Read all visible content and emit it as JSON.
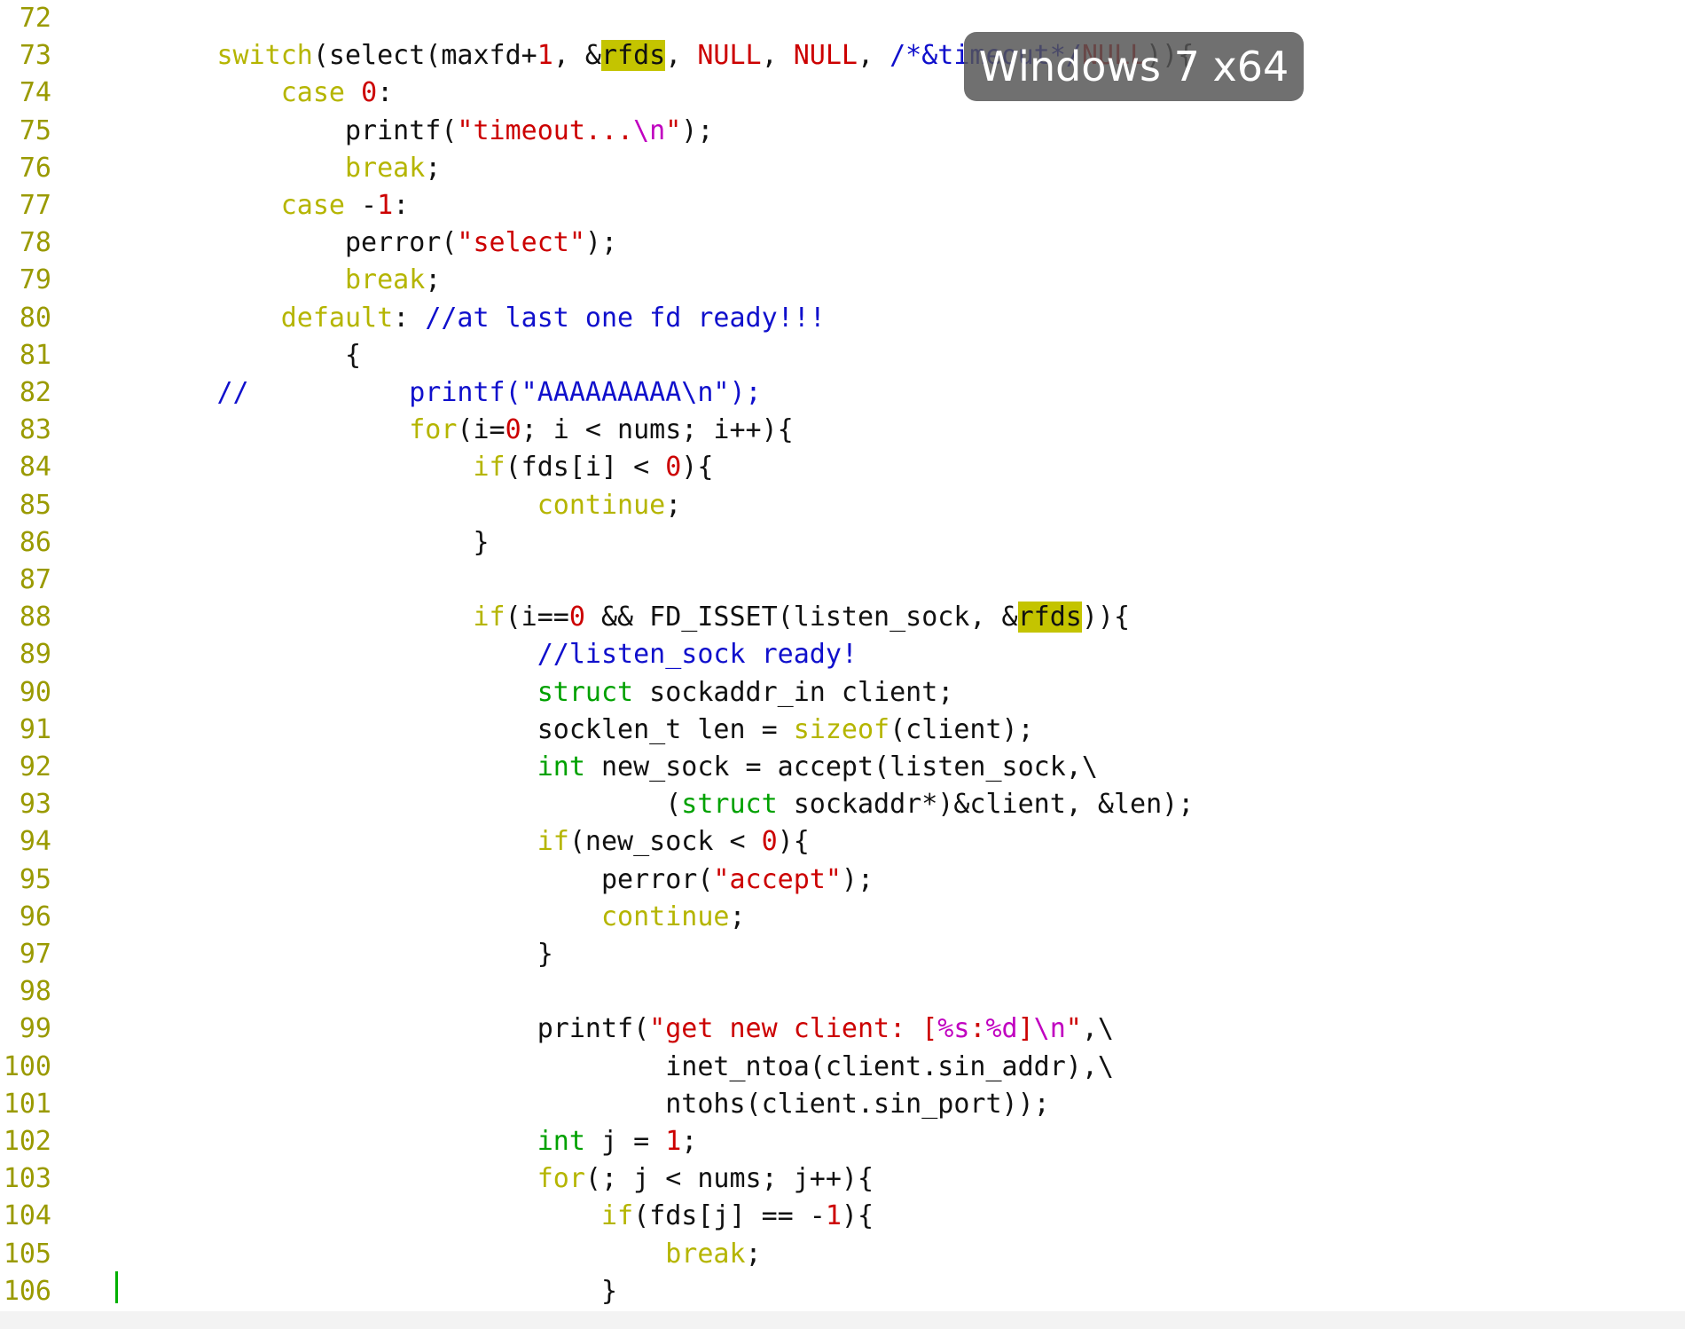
{
  "overlay": {
    "label": "Windows 7 x64"
  },
  "colors": {
    "line_number": "#9a9a00",
    "keyword": "#b5b500",
    "type": "#00a100",
    "number_string": "#cc0000",
    "escape": "#c000c0",
    "comment": "#1010cc",
    "search_highlight": "#c4c400",
    "cursor": "#00b000"
  },
  "lines": [
    {
      "n": "72",
      "tokens": []
    },
    {
      "n": "73",
      "tokens": [
        {
          "t": "        "
        },
        {
          "t": "switch",
          "c": "kw"
        },
        {
          "t": "(select(maxfd+"
        },
        {
          "t": "1",
          "c": "num"
        },
        {
          "t": ", &"
        },
        {
          "t": "rfds",
          "c": "hl"
        },
        {
          "t": ", "
        },
        {
          "t": "NULL",
          "c": "num"
        },
        {
          "t": ", "
        },
        {
          "t": "NULL",
          "c": "num"
        },
        {
          "t": ", "
        },
        {
          "t": "/*&timeout*/",
          "c": "cm"
        },
        {
          "t": "NULL",
          "c": "num"
        },
        {
          "t": ")){"
        }
      ]
    },
    {
      "n": "74",
      "tokens": [
        {
          "t": "            "
        },
        {
          "t": "case",
          "c": "kw"
        },
        {
          "t": " "
        },
        {
          "t": "0",
          "c": "num"
        },
        {
          "t": ":"
        }
      ]
    },
    {
      "n": "75",
      "tokens": [
        {
          "t": "                printf("
        },
        {
          "t": "\"timeout...",
          "c": "str"
        },
        {
          "t": "\\n",
          "c": "esc"
        },
        {
          "t": "\"",
          "c": "str"
        },
        {
          "t": ");"
        }
      ]
    },
    {
      "n": "76",
      "tokens": [
        {
          "t": "                "
        },
        {
          "t": "break",
          "c": "kw"
        },
        {
          "t": ";"
        }
      ]
    },
    {
      "n": "77",
      "tokens": [
        {
          "t": "            "
        },
        {
          "t": "case",
          "c": "kw"
        },
        {
          "t": " -"
        },
        {
          "t": "1",
          "c": "num"
        },
        {
          "t": ":"
        }
      ]
    },
    {
      "n": "78",
      "tokens": [
        {
          "t": "                perror("
        },
        {
          "t": "\"select\"",
          "c": "str"
        },
        {
          "t": ");"
        }
      ]
    },
    {
      "n": "79",
      "tokens": [
        {
          "t": "                "
        },
        {
          "t": "break",
          "c": "kw"
        },
        {
          "t": ";"
        }
      ]
    },
    {
      "n": "80",
      "tokens": [
        {
          "t": "            "
        },
        {
          "t": "default",
          "c": "kw"
        },
        {
          "t": ": "
        },
        {
          "t": "//at last one fd ready!!!",
          "c": "cm"
        }
      ]
    },
    {
      "n": "81",
      "tokens": [
        {
          "t": "                {"
        }
      ]
    },
    {
      "n": "82",
      "tokens": [
        {
          "t": "        "
        },
        {
          "t": "//          printf(\"AAAAAAAAA\\n\");",
          "c": "cm"
        }
      ]
    },
    {
      "n": "83",
      "tokens": [
        {
          "t": "                    "
        },
        {
          "t": "for",
          "c": "kw"
        },
        {
          "t": "(i="
        },
        {
          "t": "0",
          "c": "num"
        },
        {
          "t": "; i < nums; i++){"
        }
      ]
    },
    {
      "n": "84",
      "tokens": [
        {
          "t": "                        "
        },
        {
          "t": "if",
          "c": "kw"
        },
        {
          "t": "(fds[i] < "
        },
        {
          "t": "0",
          "c": "num"
        },
        {
          "t": "){"
        }
      ]
    },
    {
      "n": "85",
      "tokens": [
        {
          "t": "                            "
        },
        {
          "t": "continue",
          "c": "kw"
        },
        {
          "t": ";"
        }
      ]
    },
    {
      "n": "86",
      "tokens": [
        {
          "t": "                        }"
        }
      ]
    },
    {
      "n": "87",
      "tokens": []
    },
    {
      "n": "88",
      "tokens": [
        {
          "t": "                        "
        },
        {
          "t": "if",
          "c": "kw"
        },
        {
          "t": "(i=="
        },
        {
          "t": "0",
          "c": "num"
        },
        {
          "t": " && FD_ISSET(listen_sock, &"
        },
        {
          "t": "rfds",
          "c": "hl"
        },
        {
          "t": ")){"
        }
      ]
    },
    {
      "n": "89",
      "tokens": [
        {
          "t": "                            "
        },
        {
          "t": "//listen_sock ready!",
          "c": "cm"
        }
      ]
    },
    {
      "n": "90",
      "tokens": [
        {
          "t": "                            "
        },
        {
          "t": "struct",
          "c": "ty"
        },
        {
          "t": " sockaddr_in client;"
        }
      ]
    },
    {
      "n": "91",
      "tokens": [
        {
          "t": "                            socklen_t len = "
        },
        {
          "t": "sizeof",
          "c": "kw"
        },
        {
          "t": "(client);"
        }
      ]
    },
    {
      "n": "92",
      "tokens": [
        {
          "t": "                            "
        },
        {
          "t": "int",
          "c": "ty"
        },
        {
          "t": " new_sock = accept(listen_sock,\\"
        }
      ]
    },
    {
      "n": "93",
      "tokens": [
        {
          "t": "                                    ("
        },
        {
          "t": "struct",
          "c": "ty"
        },
        {
          "t": " sockaddr*)&client, &len);"
        }
      ]
    },
    {
      "n": "94",
      "tokens": [
        {
          "t": "                            "
        },
        {
          "t": "if",
          "c": "kw"
        },
        {
          "t": "(new_sock < "
        },
        {
          "t": "0",
          "c": "num"
        },
        {
          "t": "){"
        }
      ]
    },
    {
      "n": "95",
      "tokens": [
        {
          "t": "                                perror("
        },
        {
          "t": "\"accept\"",
          "c": "str"
        },
        {
          "t": ");"
        }
      ]
    },
    {
      "n": "96",
      "tokens": [
        {
          "t": "                                "
        },
        {
          "t": "continue",
          "c": "kw"
        },
        {
          "t": ";"
        }
      ]
    },
    {
      "n": "97",
      "tokens": [
        {
          "t": "                            }"
        }
      ]
    },
    {
      "n": "98",
      "tokens": []
    },
    {
      "n": "99",
      "tokens": [
        {
          "t": "                            printf("
        },
        {
          "t": "\"get new client: [",
          "c": "str"
        },
        {
          "t": "%s",
          "c": "esc"
        },
        {
          "t": ":",
          "c": "str"
        },
        {
          "t": "%d",
          "c": "esc"
        },
        {
          "t": "]",
          "c": "str"
        },
        {
          "t": "\\n",
          "c": "esc"
        },
        {
          "t": "\"",
          "c": "str"
        },
        {
          "t": ",\\"
        }
      ]
    },
    {
      "n": "100",
      "tokens": [
        {
          "t": "                                    inet_ntoa(client.sin_addr),\\"
        }
      ]
    },
    {
      "n": "101",
      "tokens": [
        {
          "t": "                                    ntohs(client.sin_port));"
        }
      ]
    },
    {
      "n": "102",
      "tokens": [
        {
          "t": "                            "
        },
        {
          "t": "int",
          "c": "ty"
        },
        {
          "t": " j = "
        },
        {
          "t": "1",
          "c": "num"
        },
        {
          "t": ";"
        }
      ]
    },
    {
      "n": "103",
      "tokens": [
        {
          "t": "                            "
        },
        {
          "t": "for",
          "c": "kw"
        },
        {
          "t": "(; j < nums; j++){"
        }
      ]
    },
    {
      "n": "104",
      "tokens": [
        {
          "t": "                                "
        },
        {
          "t": "if",
          "c": "kw"
        },
        {
          "t": "(fds[j] == -"
        },
        {
          "t": "1",
          "c": "num"
        },
        {
          "t": "){"
        }
      ]
    },
    {
      "n": "105",
      "tokens": [
        {
          "t": "                                    "
        },
        {
          "t": "break",
          "c": "kw"
        },
        {
          "t": ";"
        }
      ]
    },
    {
      "n": "106",
      "tokens": [
        {
          "t": "                                }"
        }
      ]
    }
  ]
}
